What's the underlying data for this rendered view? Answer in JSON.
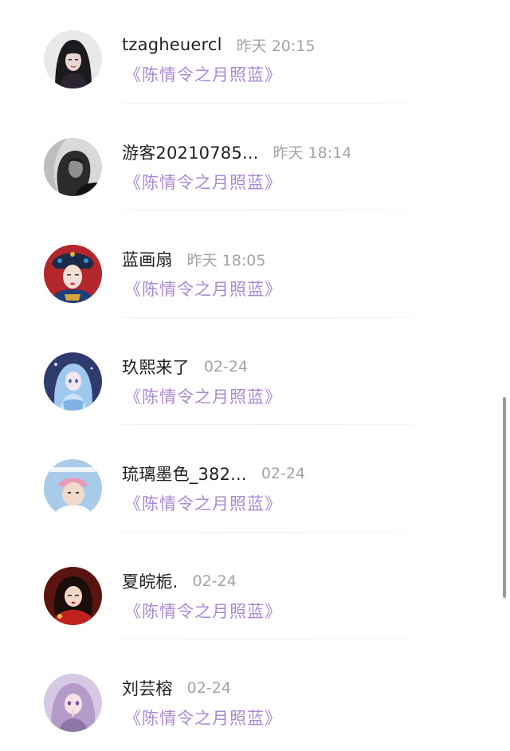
{
  "comments": [
    {
      "name": "tzagheuercl",
      "time": "昨天 20:15",
      "title": "《陈情令之月照蓝》",
      "avatar": "woman-dark-hair-icon"
    },
    {
      "name": "游客20210785...",
      "time": "昨天 18:14",
      "title": "《陈情令之月照蓝》",
      "avatar": "monochrome-portrait-icon"
    },
    {
      "name": "蓝画扇",
      "time": "昨天 18:05",
      "title": "《陈情令之月照蓝》",
      "avatar": "qing-lady-portrait-icon"
    },
    {
      "name": "玖熙来了",
      "time": "02-24",
      "title": "《陈情令之月照蓝》",
      "avatar": "anime-blue-girl-icon"
    },
    {
      "name": "琉璃墨色_382...",
      "time": "02-24",
      "title": "《陈情令之月照蓝》",
      "avatar": "child-sky-photo-icon"
    },
    {
      "name": "夏皖栀.",
      "time": "02-24",
      "title": "《陈情令之月照蓝》",
      "avatar": "girl-red-outfit-icon"
    },
    {
      "name": "刘芸榕",
      "time": "02-24",
      "title": "《陈情令之月照蓝》",
      "avatar": "anime-pink-girl-icon"
    }
  ],
  "colors": {
    "title_accent": "#a98ad2",
    "name": "#1f1f1f",
    "time": "#a3a3a3"
  }
}
